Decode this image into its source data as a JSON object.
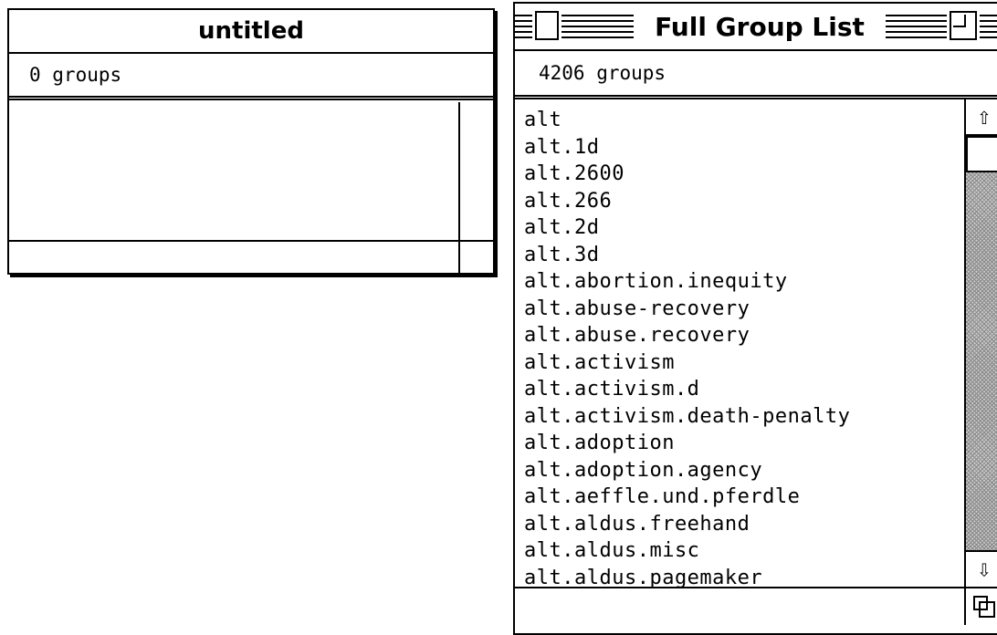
{
  "windows": {
    "untitled": {
      "title": "untitled",
      "status": "0 groups"
    },
    "full_group_list": {
      "title": "Full Group List",
      "status": "4206 groups",
      "groups": [
        "alt",
        "alt.1d",
        "alt.2600",
        "alt.266",
        "alt.2d",
        "alt.3d",
        "alt.abortion.inequity",
        "alt.abuse-recovery",
        "alt.abuse.recovery",
        "alt.activism",
        "alt.activism.d",
        "alt.activism.death-penalty",
        "alt.adoption",
        "alt.adoption.agency",
        "alt.aeffle.und.pferdle",
        "alt.aldus.freehand",
        "alt.aldus.misc",
        "alt.aldus.pagemaker"
      ],
      "scroll": {
        "up_icon": "up-arrow-icon",
        "down_icon": "down-arrow-icon"
      }
    }
  }
}
